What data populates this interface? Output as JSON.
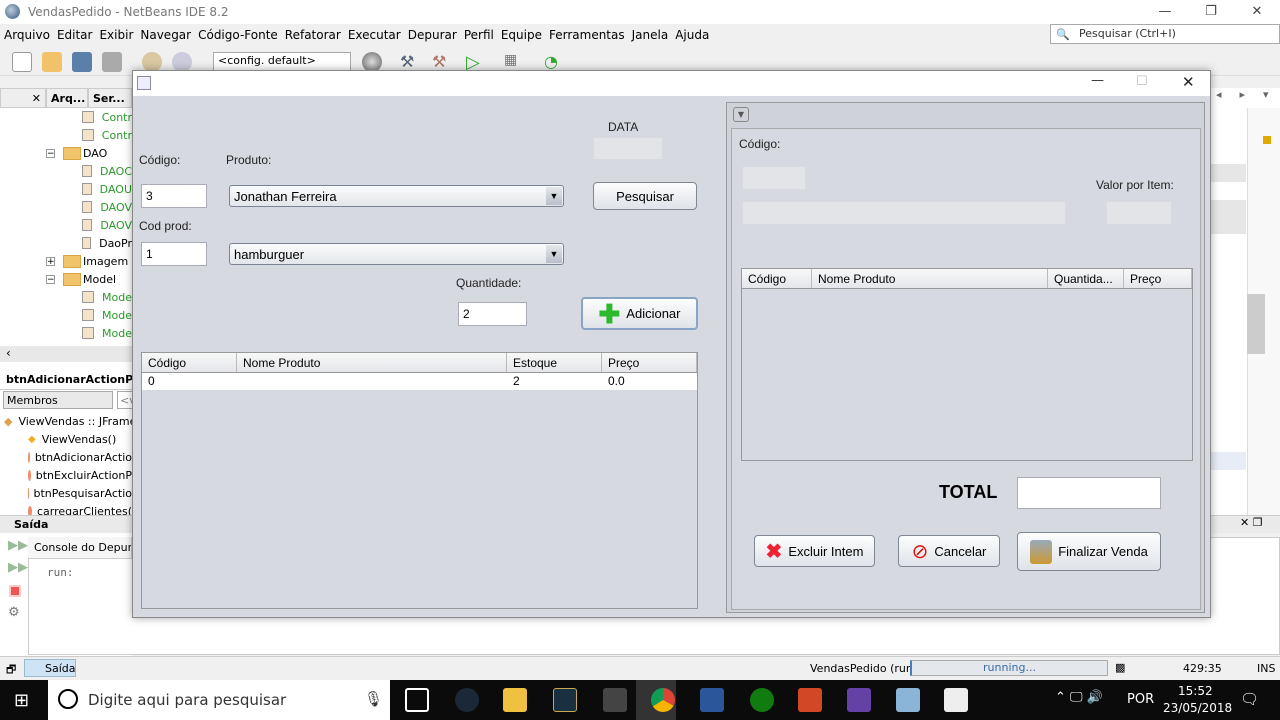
{
  "window": {
    "title": "VendasPedido - NetBeans IDE 8.2",
    "minimize": "—",
    "maximize": "❐",
    "close": "✕"
  },
  "menu": [
    "Arquivo",
    "Editar",
    "Exibir",
    "Navegar",
    "Código-Fonte",
    "Refatorar",
    "Executar",
    "Depurar",
    "Perfil",
    "Equipe",
    "Ferramentas",
    "Janela",
    "Ajuda"
  ],
  "search": {
    "placeholder": "Pesquisar (Ctrl+I)"
  },
  "toolbar": {
    "config": "<config. default>"
  },
  "project_tabs": {
    "close": "✕",
    "files": "Arq...",
    "services": "Ser..."
  },
  "tree": [
    {
      "label": "Contr",
      "type": "file",
      "green": true,
      "indent": 2
    },
    {
      "label": "Contr",
      "type": "file",
      "green": true,
      "indent": 2
    },
    {
      "label": "DAO",
      "type": "pkg",
      "indent": 1,
      "toggle": "−"
    },
    {
      "label": "DAOC",
      "type": "file",
      "green": true,
      "indent": 2
    },
    {
      "label": "DAOU",
      "type": "file",
      "green": true,
      "indent": 2
    },
    {
      "label": "DAOV",
      "type": "file",
      "green": true,
      "indent": 2
    },
    {
      "label": "DAOV",
      "type": "file",
      "green": true,
      "indent": 2
    },
    {
      "label": "DaoPr",
      "type": "file",
      "green": false,
      "indent": 2
    },
    {
      "label": "Imagem",
      "type": "pkg",
      "indent": 1,
      "toggle": "+"
    },
    {
      "label": "Model",
      "type": "pkg",
      "indent": 1,
      "toggle": "−"
    },
    {
      "label": "Mode",
      "type": "file",
      "green": true,
      "indent": 2
    },
    {
      "label": "Mode",
      "type": "file",
      "green": true,
      "indent": 2
    },
    {
      "label": "Mode",
      "type": "file",
      "green": true,
      "indent": 2
    }
  ],
  "navigator": {
    "title": "btnAdicionarActionPer",
    "filter": "Membros",
    "filter2": "<v",
    "items": [
      "ViewVendas :: JFrame",
      "ViewVendas()",
      "btnAdicionarActio",
      "btnExcluirActionP",
      "btnPesquisarActio",
      "carregarClientes("
    ]
  },
  "output": {
    "title": "Saída",
    "tab": "Console do Depurad",
    "text": "run:",
    "bottom_tab": "Saída"
  },
  "status": {
    "project": "VendasPedido (run)",
    "progress": "running...",
    "position": "429:35",
    "mode": "INS"
  },
  "taskbar": {
    "search": "Digite aqui para pesquisar",
    "lang": "POR",
    "time": "15:52",
    "date": "23/05/2018"
  },
  "dialog": {
    "labels": {
      "data": "DATA",
      "codigo": "Código:",
      "produto": "Produto:",
      "cod_prod": "Cod prod:",
      "quantidade": "Quantidade:"
    },
    "codigo": "3",
    "cliente": "Jonathan Ferreira",
    "cod_prod": "1",
    "produto": "hamburguer",
    "quantidade": "2",
    "btn_pesquisar": "Pesquisar",
    "btn_adicionar": "Adicionar",
    "stock_table": {
      "headers": [
        "Código",
        "Nome Produto",
        "Estoque",
        "Preço"
      ],
      "rows": [
        [
          "0",
          "",
          "2",
          "0.0"
        ]
      ]
    },
    "right": {
      "codigo": "Código:",
      "valor": "Valor por Item:",
      "headers": [
        "Código",
        "Nome Produto",
        "Quantida...",
        "Preço"
      ],
      "total": "TOTAL",
      "btn_excluir": "Excluir Intem",
      "btn_cancelar": "Cancelar",
      "btn_finalizar": "Finalizar Venda"
    }
  }
}
